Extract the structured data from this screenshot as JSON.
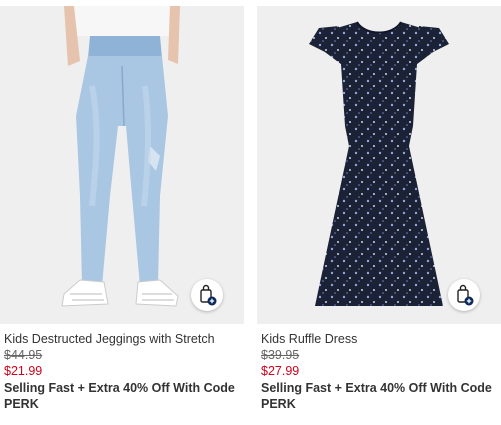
{
  "products": [
    {
      "name": "Kids Destructed Jeggings with Stretch",
      "original_price": "$44.95",
      "sale_price": "$21.99",
      "promo": "Selling Fast + Extra 40% Off With Code PERK",
      "image_icon": "product-photo-jeggings",
      "bag_icon": "shopping-bag-add-icon"
    },
    {
      "name": "Kids Ruffle Dress",
      "original_price": "$39.95",
      "sale_price": "$27.99",
      "promo": "Selling Fast + Extra 40% Off With Code PERK",
      "image_icon": "product-photo-dress",
      "bag_icon": "shopping-bag-add-icon"
    }
  ],
  "colors": {
    "sale_price": "#d0021b",
    "image_background": "#efefef",
    "bag_badge": "#0b2a5b"
  }
}
